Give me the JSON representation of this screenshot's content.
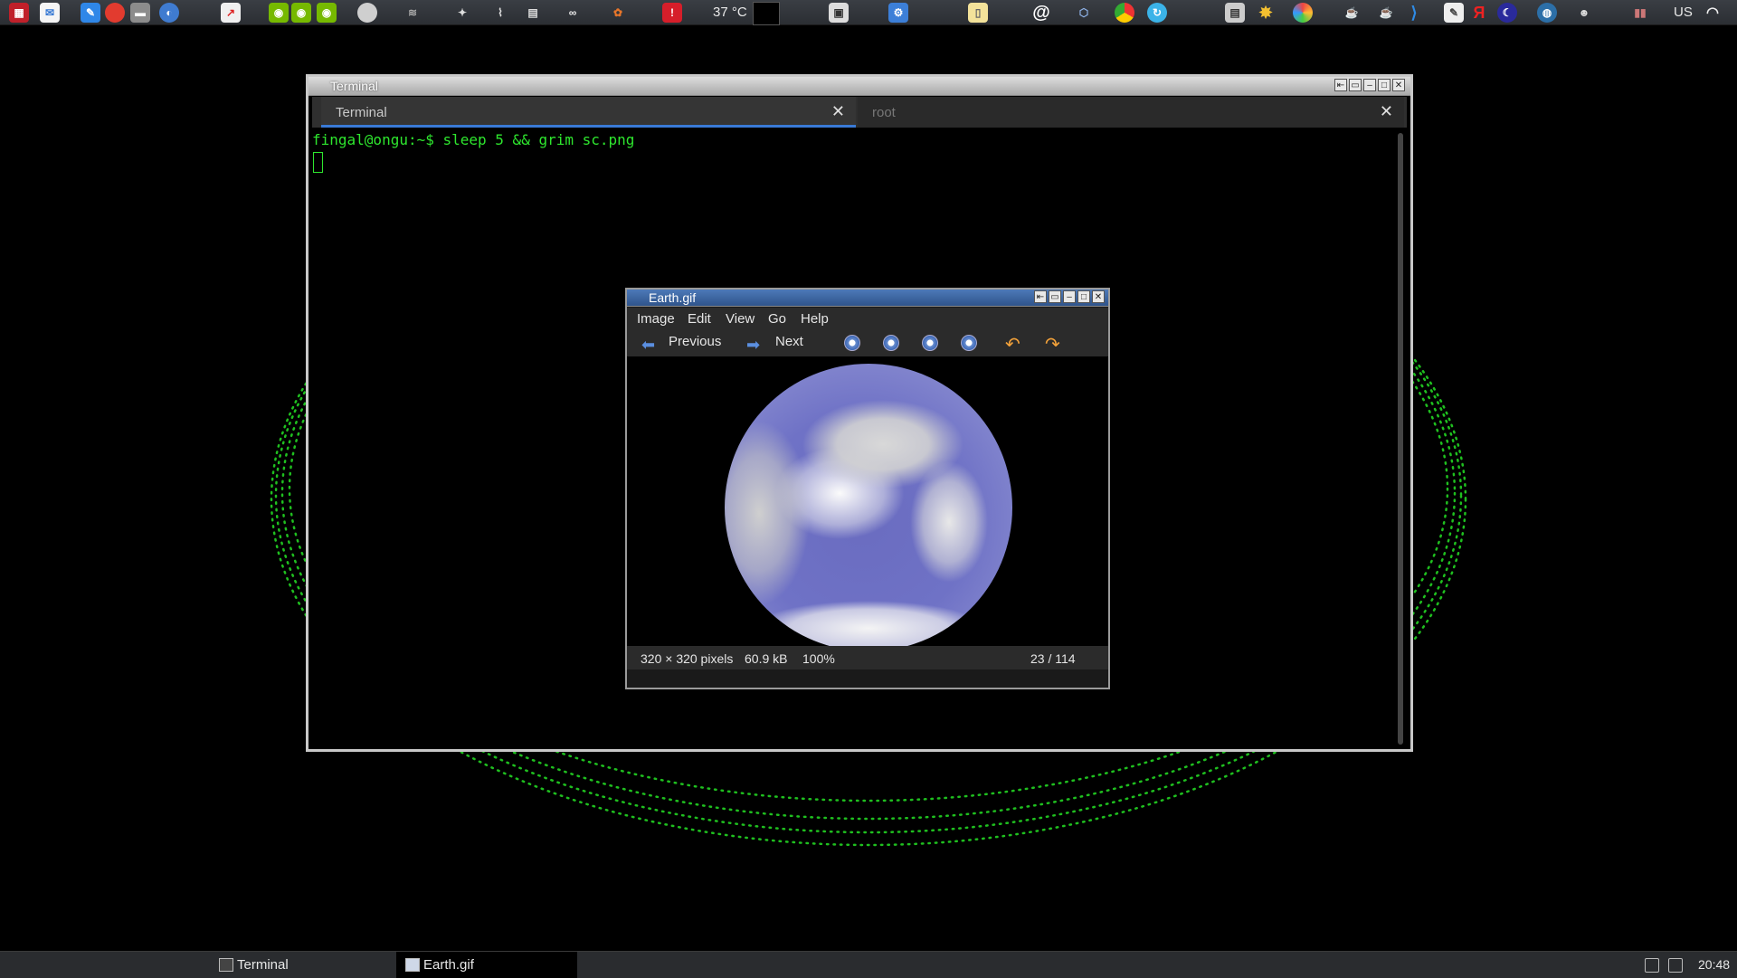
{
  "top_panel": {
    "temperature": "37 °C",
    "keyboard_layout": "US",
    "icons": [
      "app-grid-icon",
      "mail-icon",
      "notes-icon",
      "apple-icon",
      "drive-icon",
      "globe-icon",
      "chart-icon",
      "nvidia-icon",
      "nvidia-icon",
      "nvidia-icon",
      "cloud-icon",
      "antenna-icon",
      "satellite-icon",
      "plug-icon",
      "scanner-icon",
      "glasses-icon",
      "flower-icon",
      "red-alert-icon",
      "screenshot-icon",
      "settings-icon",
      "clipboard-icon",
      "at-icon",
      "package-icon",
      "chrome-icon",
      "sync-icon",
      "news-icon",
      "sun-icon",
      "color-wheel-icon",
      "coffee-icon",
      "coffee-icon",
      "vscode-icon",
      "notepad-icon",
      "yandex-icon",
      "moon-icon",
      "earth-icon",
      "people-icon",
      "books-icon",
      "wifi-icon"
    ]
  },
  "terminal": {
    "title": "Terminal",
    "tabs": [
      {
        "label": "Terminal",
        "active": true
      },
      {
        "label": "root",
        "active": false
      }
    ],
    "prompt_line": "fingal@ongu:~$ sleep 5 && grim sc.png"
  },
  "viewer": {
    "title": "Earth.gif",
    "menu": [
      "Image",
      "Edit",
      "View",
      "Go",
      "Help"
    ],
    "toolbar": {
      "previous": "Previous",
      "next": "Next"
    },
    "status": {
      "dimensions": "320 × 320 pixels",
      "size": "60.9 kB",
      "zoom": "100%",
      "position": "23 / 114"
    }
  },
  "taskbar": {
    "items": [
      {
        "label": "Terminal"
      },
      {
        "label": "Earth.gif"
      }
    ],
    "clock": "20:48"
  },
  "colors": {
    "terminal_text": "#2ee62e",
    "orbit_dots": "#1fbf1f",
    "accent_tab": "#3a7ad6"
  }
}
